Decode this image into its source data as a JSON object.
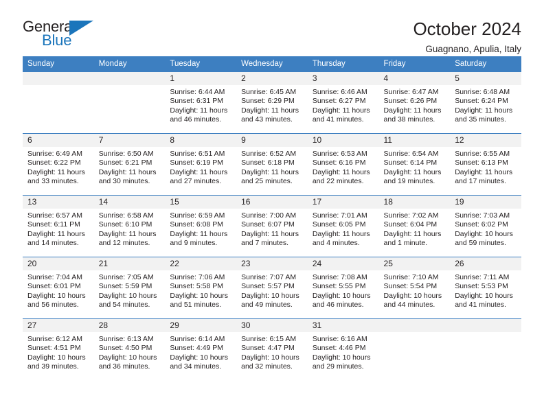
{
  "logo": {
    "word1": "General",
    "word2": "Blue",
    "triangle_color": "#1b75bb",
    "icon": "triangle-icon"
  },
  "header": {
    "title": "October 2024",
    "location": "Guagnano, Apulia, Italy"
  },
  "theme": {
    "header_bg": "#3d7fc1",
    "daynum_bg": "#f2f2f2",
    "text": "#231f20"
  },
  "weekday_headers": [
    "Sunday",
    "Monday",
    "Tuesday",
    "Wednesday",
    "Thursday",
    "Friday",
    "Saturday"
  ],
  "labels": {
    "sunrise_prefix": "Sunrise: ",
    "sunset_prefix": "Sunset: ",
    "daylight_prefix": "Daylight: "
  },
  "weeks": [
    [
      {
        "day": "",
        "blank": true
      },
      {
        "day": "",
        "blank": true
      },
      {
        "day": "1",
        "sunrise": "Sunrise: 6:44 AM",
        "sunset": "Sunset: 6:31 PM",
        "daylight1": "Daylight: 11 hours",
        "daylight2": "and 46 minutes."
      },
      {
        "day": "2",
        "sunrise": "Sunrise: 6:45 AM",
        "sunset": "Sunset: 6:29 PM",
        "daylight1": "Daylight: 11 hours",
        "daylight2": "and 43 minutes."
      },
      {
        "day": "3",
        "sunrise": "Sunrise: 6:46 AM",
        "sunset": "Sunset: 6:27 PM",
        "daylight1": "Daylight: 11 hours",
        "daylight2": "and 41 minutes."
      },
      {
        "day": "4",
        "sunrise": "Sunrise: 6:47 AM",
        "sunset": "Sunset: 6:26 PM",
        "daylight1": "Daylight: 11 hours",
        "daylight2": "and 38 minutes."
      },
      {
        "day": "5",
        "sunrise": "Sunrise: 6:48 AM",
        "sunset": "Sunset: 6:24 PM",
        "daylight1": "Daylight: 11 hours",
        "daylight2": "and 35 minutes."
      }
    ],
    [
      {
        "day": "6",
        "sunrise": "Sunrise: 6:49 AM",
        "sunset": "Sunset: 6:22 PM",
        "daylight1": "Daylight: 11 hours",
        "daylight2": "and 33 minutes."
      },
      {
        "day": "7",
        "sunrise": "Sunrise: 6:50 AM",
        "sunset": "Sunset: 6:21 PM",
        "daylight1": "Daylight: 11 hours",
        "daylight2": "and 30 minutes."
      },
      {
        "day": "8",
        "sunrise": "Sunrise: 6:51 AM",
        "sunset": "Sunset: 6:19 PM",
        "daylight1": "Daylight: 11 hours",
        "daylight2": "and 27 minutes."
      },
      {
        "day": "9",
        "sunrise": "Sunrise: 6:52 AM",
        "sunset": "Sunset: 6:18 PM",
        "daylight1": "Daylight: 11 hours",
        "daylight2": "and 25 minutes."
      },
      {
        "day": "10",
        "sunrise": "Sunrise: 6:53 AM",
        "sunset": "Sunset: 6:16 PM",
        "daylight1": "Daylight: 11 hours",
        "daylight2": "and 22 minutes."
      },
      {
        "day": "11",
        "sunrise": "Sunrise: 6:54 AM",
        "sunset": "Sunset: 6:14 PM",
        "daylight1": "Daylight: 11 hours",
        "daylight2": "and 19 minutes."
      },
      {
        "day": "12",
        "sunrise": "Sunrise: 6:55 AM",
        "sunset": "Sunset: 6:13 PM",
        "daylight1": "Daylight: 11 hours",
        "daylight2": "and 17 minutes."
      }
    ],
    [
      {
        "day": "13",
        "sunrise": "Sunrise: 6:57 AM",
        "sunset": "Sunset: 6:11 PM",
        "daylight1": "Daylight: 11 hours",
        "daylight2": "and 14 minutes."
      },
      {
        "day": "14",
        "sunrise": "Sunrise: 6:58 AM",
        "sunset": "Sunset: 6:10 PM",
        "daylight1": "Daylight: 11 hours",
        "daylight2": "and 12 minutes."
      },
      {
        "day": "15",
        "sunrise": "Sunrise: 6:59 AM",
        "sunset": "Sunset: 6:08 PM",
        "daylight1": "Daylight: 11 hours",
        "daylight2": "and 9 minutes."
      },
      {
        "day": "16",
        "sunrise": "Sunrise: 7:00 AM",
        "sunset": "Sunset: 6:07 PM",
        "daylight1": "Daylight: 11 hours",
        "daylight2": "and 7 minutes."
      },
      {
        "day": "17",
        "sunrise": "Sunrise: 7:01 AM",
        "sunset": "Sunset: 6:05 PM",
        "daylight1": "Daylight: 11 hours",
        "daylight2": "and 4 minutes."
      },
      {
        "day": "18",
        "sunrise": "Sunrise: 7:02 AM",
        "sunset": "Sunset: 6:04 PM",
        "daylight1": "Daylight: 11 hours",
        "daylight2": "and 1 minute."
      },
      {
        "day": "19",
        "sunrise": "Sunrise: 7:03 AM",
        "sunset": "Sunset: 6:02 PM",
        "daylight1": "Daylight: 10 hours",
        "daylight2": "and 59 minutes."
      }
    ],
    [
      {
        "day": "20",
        "sunrise": "Sunrise: 7:04 AM",
        "sunset": "Sunset: 6:01 PM",
        "daylight1": "Daylight: 10 hours",
        "daylight2": "and 56 minutes."
      },
      {
        "day": "21",
        "sunrise": "Sunrise: 7:05 AM",
        "sunset": "Sunset: 5:59 PM",
        "daylight1": "Daylight: 10 hours",
        "daylight2": "and 54 minutes."
      },
      {
        "day": "22",
        "sunrise": "Sunrise: 7:06 AM",
        "sunset": "Sunset: 5:58 PM",
        "daylight1": "Daylight: 10 hours",
        "daylight2": "and 51 minutes."
      },
      {
        "day": "23",
        "sunrise": "Sunrise: 7:07 AM",
        "sunset": "Sunset: 5:57 PM",
        "daylight1": "Daylight: 10 hours",
        "daylight2": "and 49 minutes."
      },
      {
        "day": "24",
        "sunrise": "Sunrise: 7:08 AM",
        "sunset": "Sunset: 5:55 PM",
        "daylight1": "Daylight: 10 hours",
        "daylight2": "and 46 minutes."
      },
      {
        "day": "25",
        "sunrise": "Sunrise: 7:10 AM",
        "sunset": "Sunset: 5:54 PM",
        "daylight1": "Daylight: 10 hours",
        "daylight2": "and 44 minutes."
      },
      {
        "day": "26",
        "sunrise": "Sunrise: 7:11 AM",
        "sunset": "Sunset: 5:53 PM",
        "daylight1": "Daylight: 10 hours",
        "daylight2": "and 41 minutes."
      }
    ],
    [
      {
        "day": "27",
        "sunrise": "Sunrise: 6:12 AM",
        "sunset": "Sunset: 4:51 PM",
        "daylight1": "Daylight: 10 hours",
        "daylight2": "and 39 minutes."
      },
      {
        "day": "28",
        "sunrise": "Sunrise: 6:13 AM",
        "sunset": "Sunset: 4:50 PM",
        "daylight1": "Daylight: 10 hours",
        "daylight2": "and 36 minutes."
      },
      {
        "day": "29",
        "sunrise": "Sunrise: 6:14 AM",
        "sunset": "Sunset: 4:49 PM",
        "daylight1": "Daylight: 10 hours",
        "daylight2": "and 34 minutes."
      },
      {
        "day": "30",
        "sunrise": "Sunrise: 6:15 AM",
        "sunset": "Sunset: 4:47 PM",
        "daylight1": "Daylight: 10 hours",
        "daylight2": "and 32 minutes."
      },
      {
        "day": "31",
        "sunrise": "Sunrise: 6:16 AM",
        "sunset": "Sunset: 4:46 PM",
        "daylight1": "Daylight: 10 hours",
        "daylight2": "and 29 minutes."
      },
      {
        "day": "",
        "blank": true
      },
      {
        "day": "",
        "blank": true
      }
    ]
  ]
}
